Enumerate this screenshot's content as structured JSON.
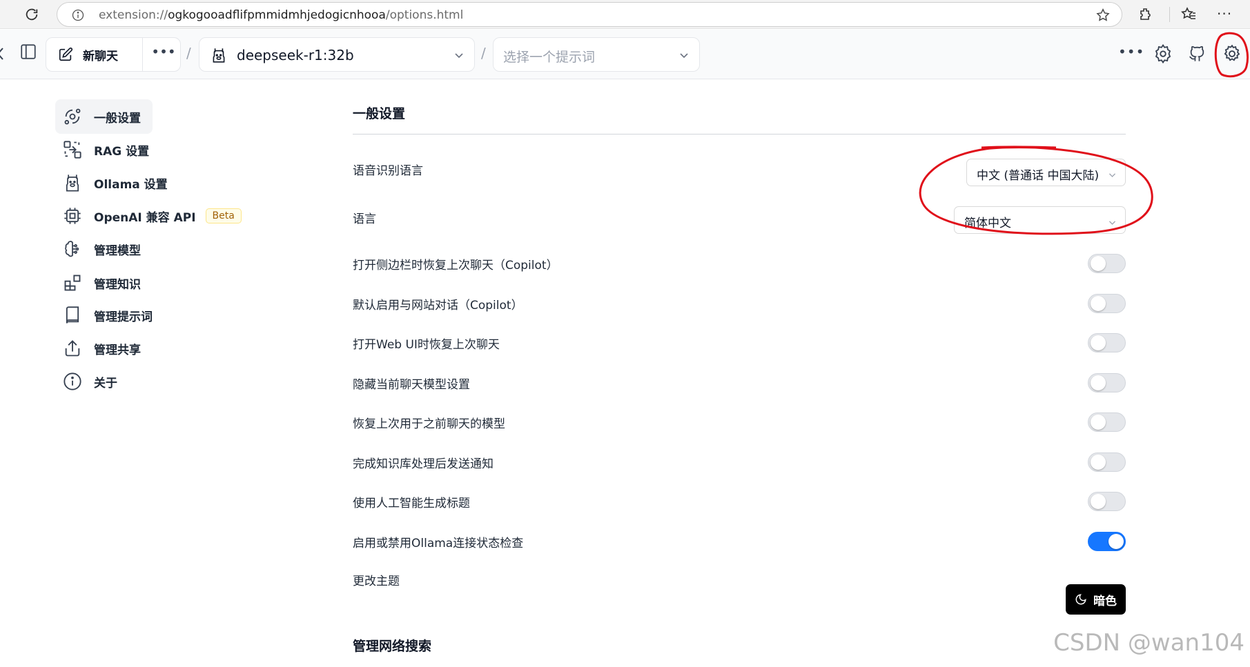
{
  "browser": {
    "url_prefix": "extension://",
    "url_host": "ogkogooadflifpmmidmhjedogicnhooa",
    "url_path": "/options.html"
  },
  "header": {
    "new_chat_label": "新聊天",
    "more_glyph": "•••",
    "separator": "/",
    "model_name": "deepseek-r1:32b",
    "prompt_placeholder": "选择一个提示词"
  },
  "sidebar": {
    "items": [
      {
        "label": "一般设置",
        "icon": "orbit-icon",
        "active": true
      },
      {
        "label": "RAG 设置",
        "icon": "combine-icon",
        "active": false
      },
      {
        "label": "Ollama 设置",
        "icon": "llama-icon",
        "active": false
      },
      {
        "label": "OpenAI 兼容 API",
        "icon": "chip-icon",
        "active": false,
        "badge": "Beta"
      },
      {
        "label": "管理模型",
        "icon": "brain-icon",
        "active": false
      },
      {
        "label": "管理知识",
        "icon": "blocks-icon",
        "active": false
      },
      {
        "label": "管理提示词",
        "icon": "book-icon",
        "active": false
      },
      {
        "label": "管理共享",
        "icon": "share-icon",
        "active": false
      },
      {
        "label": "关于",
        "icon": "info-icon",
        "active": false
      }
    ]
  },
  "main": {
    "section_title": "一般设置",
    "speech_language_label": "语音识别语言",
    "speech_language_value": "中文 (普通话 中国大陆)",
    "language_label": "语言",
    "language_value": "简体中文",
    "toggles": [
      {
        "label": "打开侧边栏时恢复上次聊天（Copilot）",
        "on": false
      },
      {
        "label": "默认启用与网站对话（Copilot）",
        "on": false
      },
      {
        "label": "打开Web UI时恢复上次聊天",
        "on": false
      },
      {
        "label": "隐藏当前聊天模型设置",
        "on": false
      },
      {
        "label": "恢复上次用于之前聊天的模型",
        "on": false
      },
      {
        "label": "完成知识库处理后发送通知",
        "on": false
      },
      {
        "label": "使用人工智能生成标题",
        "on": false
      },
      {
        "label": "启用或禁用Ollama连接状态检查",
        "on": true
      }
    ],
    "theme_label": "更改主题",
    "theme_button": "暗色",
    "section_title_2": "管理网络搜索"
  },
  "watermark": "CSDN @wan104",
  "colors": {
    "toggle_on": "#1677ff",
    "annotation_red": "#e0101a"
  }
}
